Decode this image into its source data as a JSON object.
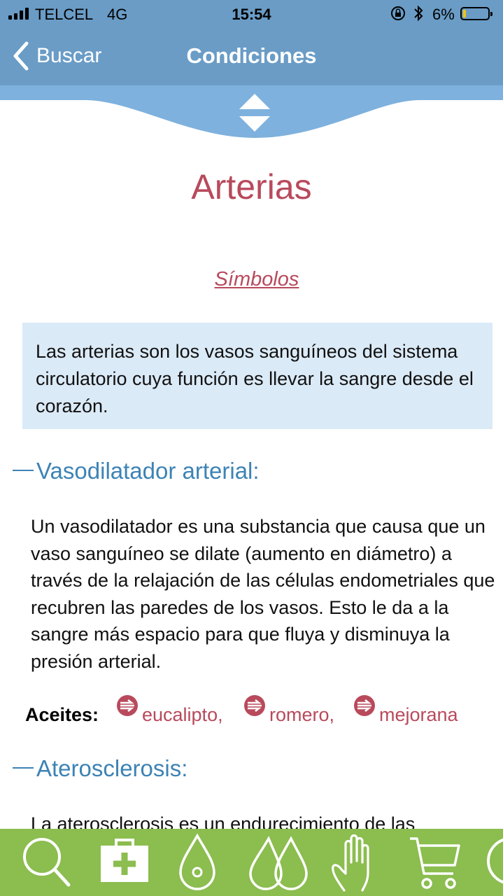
{
  "status_bar": {
    "carrier": "TELCEL",
    "network": "4G",
    "time": "15:54",
    "battery_percent": "6%",
    "battery_level": 0.06,
    "battery_color": "#f1c40f",
    "icons": [
      "signal-icon",
      "orientation-lock-icon",
      "bluetooth-icon",
      "battery-icon"
    ]
  },
  "nav": {
    "back_label": "Buscar",
    "title": "Condiciones",
    "background": "#6a9cc6"
  },
  "page": {
    "title": "Arterias",
    "symbols_link": "Símbolos",
    "intro": "Las arterias son los vasos sanguíneos del sistema circulatorio cuya función es llevar la sangre desde el corazón.",
    "sections": [
      {
        "title": "Vasodilatador arterial:",
        "body": "Un vasodilatador es una substancia que causa que un vaso sanguíneo se dilate (aumento en diámetro) a través de la relajación de las células endometriales que recubren las paredes de los vasos. Esto le da a la sangre más espacio para que fluya y disminuya la presión arterial.",
        "oils_label": "Aceites:",
        "oils": [
          "eucalipto,",
          "romero,",
          "mejorana"
        ]
      },
      {
        "title": "Aterosclerosis:",
        "body": "La aterosclerosis es un endurecimiento de las"
      }
    ]
  },
  "tab_bar": {
    "background": "#8bbd4f",
    "tabs": [
      "search-icon",
      "first-aid-kit-icon",
      "single-drop-icon",
      "double-drop-icon",
      "hand-icon",
      "cart-icon",
      "more-icon"
    ]
  },
  "colors": {
    "accent": "#b84a5c",
    "section_blue": "#3d83b4",
    "intro_bg": "#dbeaf7"
  }
}
